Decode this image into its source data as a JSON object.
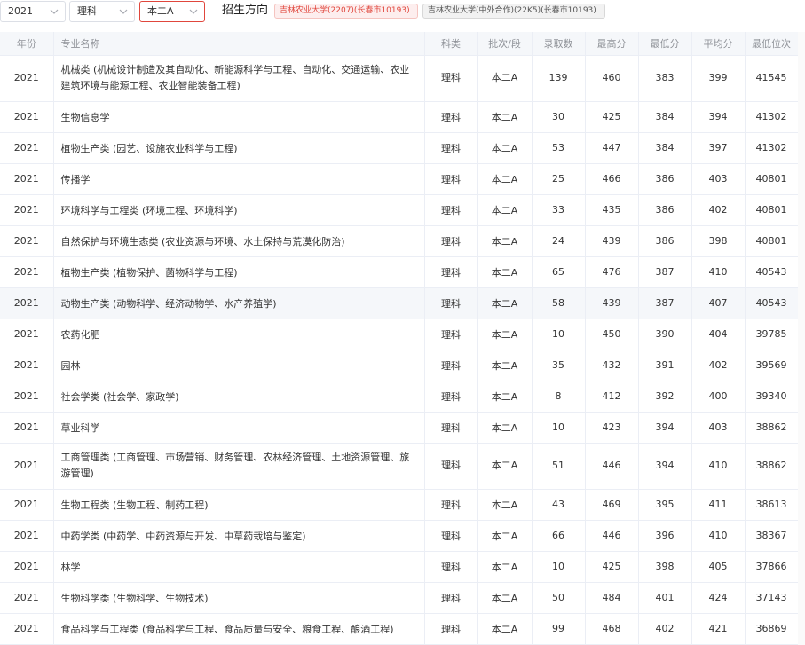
{
  "filters": {
    "year": "2021",
    "subject": "理科",
    "batch": "本二A",
    "direction_label": "招生方向",
    "tags": [
      "吉林农业大学(2207)(长春市10193)",
      "吉林农业大学(中外合作)(22K5)(长春市10193)"
    ]
  },
  "table": {
    "headers": [
      "年份",
      "专业名称",
      "科类",
      "批次/段",
      "录取数",
      "最高分",
      "最低分",
      "平均分",
      "最低位次"
    ],
    "rows": [
      {
        "year": "2021",
        "name": "机械类 (机械设计制造及其自动化、新能源科学与工程、自动化、交通运输、农业建筑环境与能源工程、农业智能装备工程)",
        "subject": "理科",
        "batch": "本二A",
        "count": "139",
        "max": "460",
        "min": "383",
        "avg": "399",
        "rank": "41545"
      },
      {
        "year": "2021",
        "name": "生物信息学",
        "subject": "理科",
        "batch": "本二A",
        "count": "30",
        "max": "425",
        "min": "384",
        "avg": "394",
        "rank": "41302"
      },
      {
        "year": "2021",
        "name": "植物生产类 (园艺、设施农业科学与工程)",
        "subject": "理科",
        "batch": "本二A",
        "count": "53",
        "max": "447",
        "min": "384",
        "avg": "397",
        "rank": "41302"
      },
      {
        "year": "2021",
        "name": "传播学",
        "subject": "理科",
        "batch": "本二A",
        "count": "25",
        "max": "466",
        "min": "386",
        "avg": "403",
        "rank": "40801"
      },
      {
        "year": "2021",
        "name": "环境科学与工程类 (环境工程、环境科学)",
        "subject": "理科",
        "batch": "本二A",
        "count": "33",
        "max": "435",
        "min": "386",
        "avg": "402",
        "rank": "40801"
      },
      {
        "year": "2021",
        "name": "自然保护与环境生态类 (农业资源与环境、水土保持与荒漠化防治)",
        "subject": "理科",
        "batch": "本二A",
        "count": "24",
        "max": "439",
        "min": "386",
        "avg": "398",
        "rank": "40801"
      },
      {
        "year": "2021",
        "name": "植物生产类 (植物保护、菌物科学与工程)",
        "subject": "理科",
        "batch": "本二A",
        "count": "65",
        "max": "476",
        "min": "387",
        "avg": "410",
        "rank": "40543"
      },
      {
        "year": "2021",
        "name": "动物生产类 (动物科学、经济动物学、水产养殖学)",
        "subject": "理科",
        "batch": "本二A",
        "count": "58",
        "max": "439",
        "min": "387",
        "avg": "407",
        "rank": "40543"
      },
      {
        "year": "2021",
        "name": "农药化肥",
        "subject": "理科",
        "batch": "本二A",
        "count": "10",
        "max": "450",
        "min": "390",
        "avg": "404",
        "rank": "39785"
      },
      {
        "year": "2021",
        "name": "园林",
        "subject": "理科",
        "batch": "本二A",
        "count": "35",
        "max": "432",
        "min": "391",
        "avg": "402",
        "rank": "39569"
      },
      {
        "year": "2021",
        "name": "社会学类 (社会学、家政学)",
        "subject": "理科",
        "batch": "本二A",
        "count": "8",
        "max": "412",
        "min": "392",
        "avg": "400",
        "rank": "39340"
      },
      {
        "year": "2021",
        "name": "草业科学",
        "subject": "理科",
        "batch": "本二A",
        "count": "10",
        "max": "423",
        "min": "394",
        "avg": "403",
        "rank": "38862"
      },
      {
        "year": "2021",
        "name": "工商管理类 (工商管理、市场营销、财务管理、农林经济管理、土地资源管理、旅游管理)",
        "subject": "理科",
        "batch": "本二A",
        "count": "51",
        "max": "446",
        "min": "394",
        "avg": "410",
        "rank": "38862"
      },
      {
        "year": "2021",
        "name": "生物工程类 (生物工程、制药工程)",
        "subject": "理科",
        "batch": "本二A",
        "count": "43",
        "max": "469",
        "min": "395",
        "avg": "411",
        "rank": "38613"
      },
      {
        "year": "2021",
        "name": "中药学类 (中药学、中药资源与开发、中草药栽培与鉴定)",
        "subject": "理科",
        "batch": "本二A",
        "count": "66",
        "max": "446",
        "min": "396",
        "avg": "410",
        "rank": "38367"
      },
      {
        "year": "2021",
        "name": "林学",
        "subject": "理科",
        "batch": "本二A",
        "count": "10",
        "max": "425",
        "min": "398",
        "avg": "405",
        "rank": "37866"
      },
      {
        "year": "2021",
        "name": "生物科学类 (生物科学、生物技术)",
        "subject": "理科",
        "batch": "本二A",
        "count": "50",
        "max": "484",
        "min": "401",
        "avg": "424",
        "rank": "37143"
      },
      {
        "year": "2021",
        "name": "食品科学与工程类 (食品科学与工程、食品质量与安全、粮食工程、酿酒工程)",
        "subject": "理科",
        "batch": "本二A",
        "count": "99",
        "max": "468",
        "min": "402",
        "avg": "421",
        "rank": "36869"
      }
    ]
  }
}
